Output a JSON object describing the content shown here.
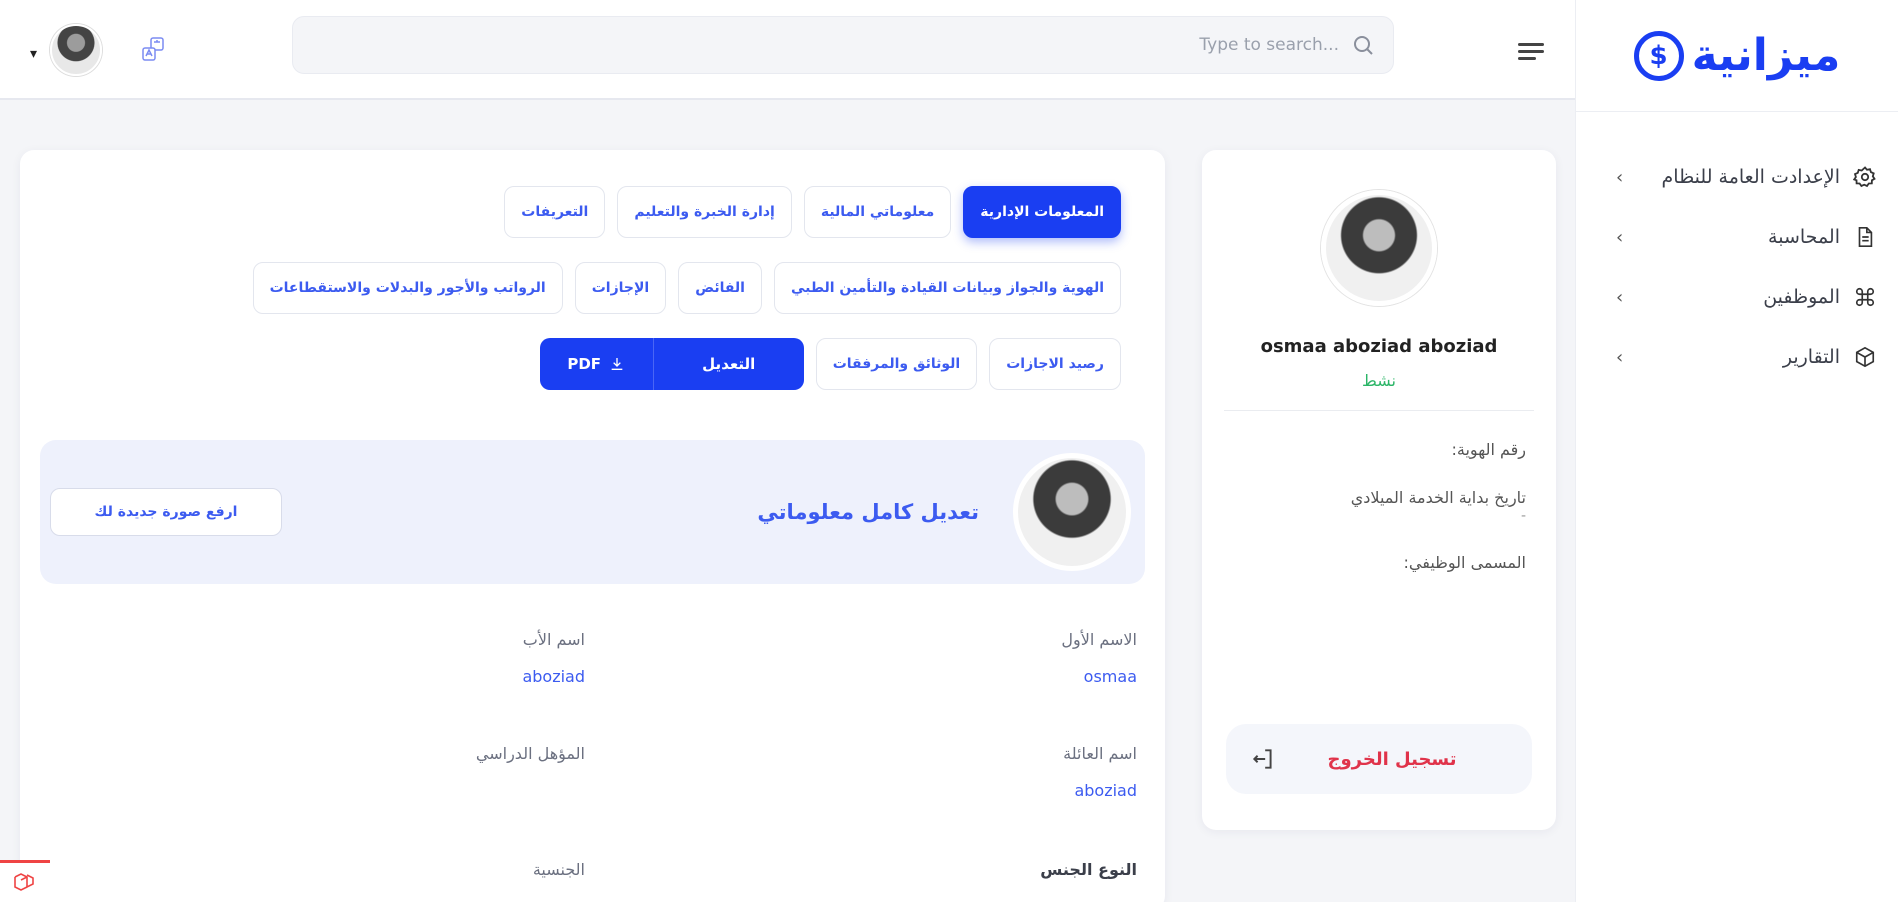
{
  "brand": {
    "name": "ميزانية",
    "coin_symbol": "$"
  },
  "sidebar": {
    "items": [
      {
        "label": "الإعدادت العامة للنظام",
        "icon": "gear-icon"
      },
      {
        "label": "المحاسبة",
        "icon": "document-icon"
      },
      {
        "label": "الموظفين",
        "icon": "command-icon"
      },
      {
        "label": "التقارير",
        "icon": "cube-icon"
      }
    ],
    "chevron": "›"
  },
  "header": {
    "search_placeholder": "Type to search...",
    "caret": "▾"
  },
  "profile": {
    "name": "osmaa aboziad aboziad",
    "status": "نشط",
    "fields": [
      {
        "label": "رقم الهوية:",
        "value": ""
      },
      {
        "label": "تاريخ بداية الخدمة الميلادي",
        "value": "-"
      },
      {
        "label": "المسمى الوظيفي:",
        "value": ""
      }
    ],
    "logout_label": "تسجيل الخروج"
  },
  "tabs": {
    "row1": [
      {
        "label": "المعلومات الإدارية",
        "active": true
      },
      {
        "label": "معلوماتي المالية",
        "active": false
      },
      {
        "label": "إدارة الخبرة والتعليم",
        "active": false
      },
      {
        "label": "التعريفات",
        "active": false
      }
    ],
    "row2": [
      {
        "label": "الهوية والجواز وبيانات القيادة والتأمين الطبي",
        "active": false
      },
      {
        "label": "الفائض",
        "active": false
      },
      {
        "label": "الإجازات",
        "active": false
      },
      {
        "label": "الرواتب والأجور والبدلات والاستقطاعات",
        "active": false
      }
    ],
    "row3": [
      {
        "label": "رصيد الاجازات",
        "active": false
      },
      {
        "label": "الوثائق والمرفقات",
        "active": false
      }
    ],
    "edit_label": "التعديل",
    "pdf_label": "PDF"
  },
  "banner": {
    "title": "تعديل كامل معلوماتي",
    "button_label": "ارفع صورة جديدة لك"
  },
  "info": [
    {
      "label": "الاسم الأول",
      "value": "osmaa"
    },
    {
      "label": "اسم الأب",
      "value": "aboziad"
    },
    {
      "label": "اسم العائلة",
      "value": "aboziad"
    },
    {
      "label": "المؤهل الدراسي",
      "value": ""
    },
    {
      "label": "النوع الجنس",
      "value": ""
    },
    {
      "label": "الجنسية",
      "value": ""
    }
  ],
  "colors": {
    "primary": "#1a3ef2",
    "link": "#3c5bf0",
    "success": "#2bb567",
    "danger": "#e0334a",
    "banner_bg": "#eef1fc"
  }
}
